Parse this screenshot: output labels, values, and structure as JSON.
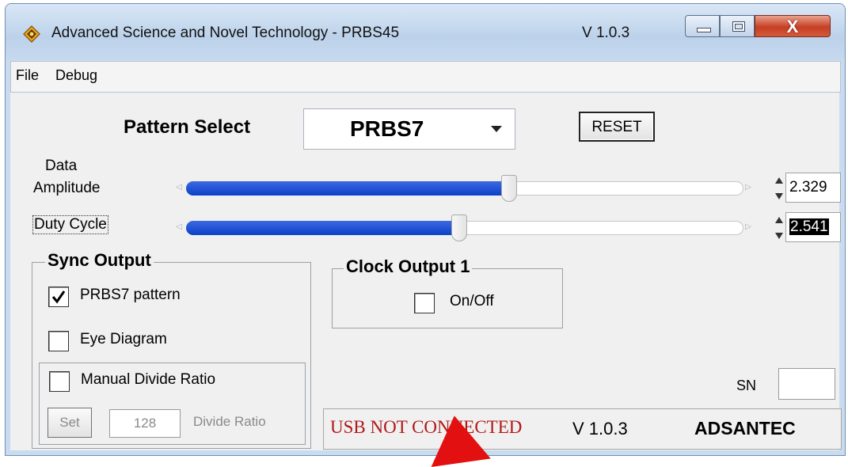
{
  "window": {
    "title": "Advanced Science and Novel Technology - PRBS45",
    "version": "V 1.0.3",
    "close_glyph": "X"
  },
  "menu": {
    "items": [
      "File",
      "Debug"
    ]
  },
  "pattern": {
    "label": "Pattern Select",
    "selected": "PRBS7",
    "reset_label": "RESET"
  },
  "sliders": {
    "amplitude": {
      "label_line1": "Data",
      "label_line2": "Amplitude",
      "value": "2.329",
      "fraction": 0.58
    },
    "duty": {
      "label": "Duty Cycle",
      "value": "2.541",
      "fraction": 0.49
    }
  },
  "sync": {
    "title": "Sync Output",
    "prbs7": {
      "label": "PRBS7 pattern",
      "checked": true
    },
    "eye": {
      "label": "Eye Diagram",
      "checked": false
    },
    "manual": {
      "label": "Manual Divide Ratio",
      "checked": false
    },
    "set_label": "Set",
    "divide_value": "128",
    "divide_label": "Divide Ratio"
  },
  "clock": {
    "title": "Clock Output 1",
    "onoff_label": "On/Off",
    "checked": false
  },
  "sn_label": "SN",
  "status": {
    "usb": "USB NOT CONNECTED",
    "version": "V 1.0.3",
    "brand": "ADSANTEC"
  },
  "colors": {
    "slider_fill": "#1a4fd6",
    "status_text": "#b01818",
    "arrow": "#e21010"
  }
}
